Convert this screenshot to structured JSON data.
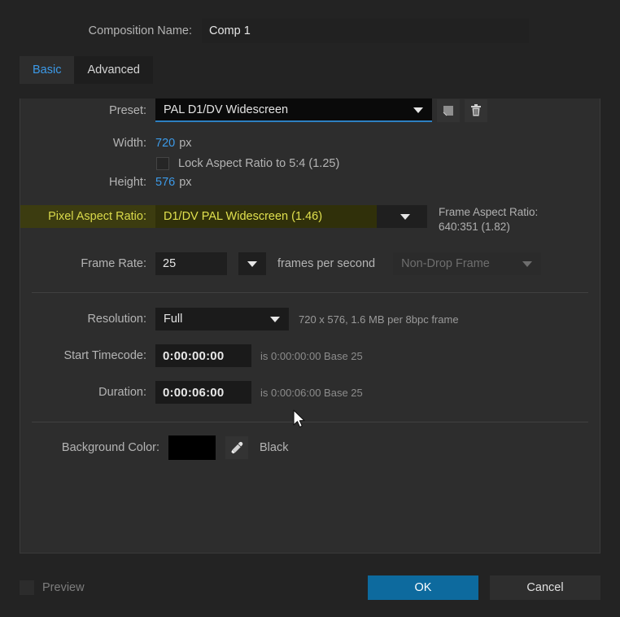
{
  "dialog": {
    "composition_name_label": "Composition Name:",
    "composition_name_value": "Comp 1",
    "composition_name_placeholder": "Comp 1"
  },
  "tabs": [
    {
      "label": "Basic",
      "active": true
    },
    {
      "label": "Advanced",
      "active": false
    }
  ],
  "basic": {
    "preset_label": "Preset:",
    "preset_value": "PAL D1/DV Widescreen",
    "save_preset_icon": "save-preset-icon",
    "delete_preset_icon": "trash-icon",
    "width_label": "Width:",
    "width_value": "720",
    "width_unit": "px",
    "height_label": "Height:",
    "height_value": "576",
    "height_unit": "px",
    "lock_aspect_label": "Lock Aspect Ratio to 5:4 (1.25)",
    "lock_aspect_checked": false,
    "par_label": "Pixel Aspect Ratio:",
    "par_value": "D1/DV PAL Widescreen (1.46)",
    "frame_aspect_label": "Frame Aspect Ratio:",
    "frame_aspect_value": "640:351 (1.82)",
    "frame_rate_label": "Frame Rate:",
    "frame_rate_value": "25",
    "frame_rate_unit": "frames per second",
    "drop_frame_value": "Non-Drop Frame",
    "resolution_label": "Resolution:",
    "resolution_value": "Full",
    "resolution_note": "720 x 576, 1.6 MB per 8bpc frame",
    "start_timecode_label": "Start Timecode:",
    "start_timecode_value": "0:00:00:00",
    "start_timecode_note": "is 0:00:00:00  Base 25",
    "duration_label": "Duration:",
    "duration_value": "0:00:06:00",
    "duration_note": "is 0:00:06:00  Base 25",
    "background_color_label": "Background Color:",
    "background_color_hex": "#000000",
    "eyedropper_icon": "eyedropper-icon",
    "background_color_name": "Black"
  },
  "footer": {
    "preview_label": "Preview",
    "preview_checked": false,
    "ok_label": "OK",
    "cancel_label": "Cancel"
  },
  "theme": {
    "accent_blue": "#3c9ae8",
    "button_blue": "#0d6a9e",
    "highlight_yellow": "#d9d94a",
    "panel_bg": "#2d2d2d",
    "window_bg": "#232323"
  }
}
